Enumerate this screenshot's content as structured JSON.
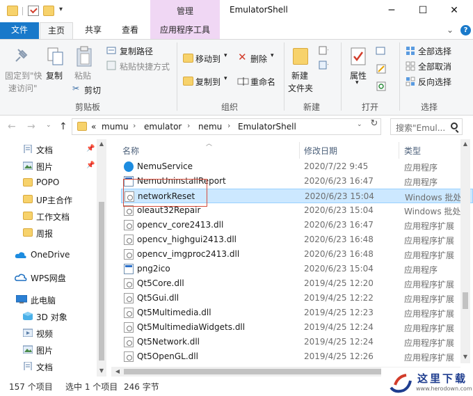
{
  "window": {
    "title": "EmulatorShell",
    "context_tab_group": "管理",
    "controls": {
      "minimize": "─",
      "maximize": "☐",
      "close": "✕"
    }
  },
  "ribbon_tabs": [
    "文件",
    "主页",
    "共享",
    "查看",
    "应用程序工具"
  ],
  "ribbon": {
    "clipboard": {
      "pin_to_quick_access": "固定到快速访问",
      "pin_line1": "固定到\"快",
      "pin_line2": "速访问\"",
      "copy": "复制",
      "paste": "粘贴",
      "copy_path": "复制路径",
      "paste_shortcut": "粘贴快捷方式",
      "cut": "剪切",
      "group_label": "剪贴板"
    },
    "organize": {
      "move_to": "移动到",
      "copy_to": "复制到",
      "delete": "删除",
      "rename": "重命名",
      "group_label": "组织"
    },
    "new": {
      "new_folder_line1": "新建",
      "new_folder_line2": "文件夹",
      "group_label": "新建"
    },
    "open": {
      "properties": "属性",
      "group_label": "打开"
    },
    "select": {
      "select_all": "全部选择",
      "select_none": "全部取消",
      "invert_selection": "反向选择",
      "group_label": "选择"
    }
  },
  "address": {
    "overflow": "«",
    "crumbs": [
      "mumu",
      "emulator",
      "nemu",
      "EmulatorShell"
    ],
    "search_placeholder": "搜索\"Emul...",
    "separator": "›"
  },
  "nav_pane": {
    "items": [
      {
        "label": "文档",
        "icon": "documents-icon",
        "pinned": true
      },
      {
        "label": "图片",
        "icon": "pictures-icon",
        "pinned": true
      },
      {
        "label": "POPO",
        "icon": "folder-icon",
        "pinned": false
      },
      {
        "label": "UP主合作",
        "icon": "folder-icon",
        "pinned": false
      },
      {
        "label": "工作文档",
        "icon": "folder-icon",
        "pinned": false
      },
      {
        "label": "周报",
        "icon": "folder-icon",
        "pinned": false
      },
      {
        "label": "OneDrive",
        "icon": "cloud-icon",
        "pinned": false
      },
      {
        "label": "WPS网盘",
        "icon": "cloud-icon",
        "pinned": false
      },
      {
        "label": "此电脑",
        "icon": "computer-icon",
        "pinned": false
      },
      {
        "label": "3D 对象",
        "icon": "3d-objects-icon",
        "pinned": false
      },
      {
        "label": "视频",
        "icon": "videos-icon",
        "pinned": false
      },
      {
        "label": "图片",
        "icon": "pictures-icon",
        "pinned": false
      },
      {
        "label": "文档",
        "icon": "documents-icon",
        "pinned": false
      }
    ]
  },
  "columns": {
    "name": "名称",
    "modified": "修改日期",
    "type": "类型"
  },
  "files": [
    {
      "name": "NemuService",
      "date": "2020/7/22 9:45",
      "type": "应用程序",
      "icon": "app-blue-icon"
    },
    {
      "name": "NemuUninstallReport",
      "date": "2020/6/23 16:47",
      "type": "应用程序",
      "icon": "app-window-icon"
    },
    {
      "name": "networkReset",
      "date": "2020/6/23 15:04",
      "type": "Windows 批处理",
      "icon": "batch-file-icon",
      "selected": true
    },
    {
      "name": "oleaut32Repair",
      "date": "2020/6/23 15:04",
      "type": "Windows 批处理",
      "icon": "batch-file-icon"
    },
    {
      "name": "opencv_core2413.dll",
      "date": "2020/6/23 16:47",
      "type": "应用程序扩展",
      "icon": "dll-file-icon"
    },
    {
      "name": "opencv_highgui2413.dll",
      "date": "2020/6/23 16:48",
      "type": "应用程序扩展",
      "icon": "dll-file-icon"
    },
    {
      "name": "opencv_imgproc2413.dll",
      "date": "2020/6/23 16:48",
      "type": "应用程序扩展",
      "icon": "dll-file-icon"
    },
    {
      "name": "png2ico",
      "date": "2020/6/23 15:04",
      "type": "应用程序",
      "icon": "app-window-icon"
    },
    {
      "name": "Qt5Core.dll",
      "date": "2019/4/25 12:20",
      "type": "应用程序扩展",
      "icon": "dll-file-icon"
    },
    {
      "name": "Qt5Gui.dll",
      "date": "2019/4/25 12:22",
      "type": "应用程序扩展",
      "icon": "dll-file-icon"
    },
    {
      "name": "Qt5Multimedia.dll",
      "date": "2019/4/25 12:23",
      "type": "应用程序扩展",
      "icon": "dll-file-icon"
    },
    {
      "name": "Qt5MultimediaWidgets.dll",
      "date": "2019/4/25 12:24",
      "type": "应用程序扩展",
      "icon": "dll-file-icon"
    },
    {
      "name": "Qt5Network.dll",
      "date": "2019/4/25 12:24",
      "type": "应用程序扩展",
      "icon": "dll-file-icon"
    },
    {
      "name": "Qt5OpenGL.dll",
      "date": "2019/4/25 12:26",
      "type": "应用程序扩展",
      "icon": "dll-file-icon"
    }
  ],
  "status": {
    "item_count": "157 个项目",
    "selection": "选中 1 个项目",
    "size": "246 字节"
  },
  "watermark": {
    "title": "这里下载",
    "url": "www.herodown.com"
  },
  "colors": {
    "accent": "#1979ca",
    "context_tab": "#f0d7f4",
    "selection": "#cce8ff",
    "highlight_box": "#d44b3a"
  }
}
